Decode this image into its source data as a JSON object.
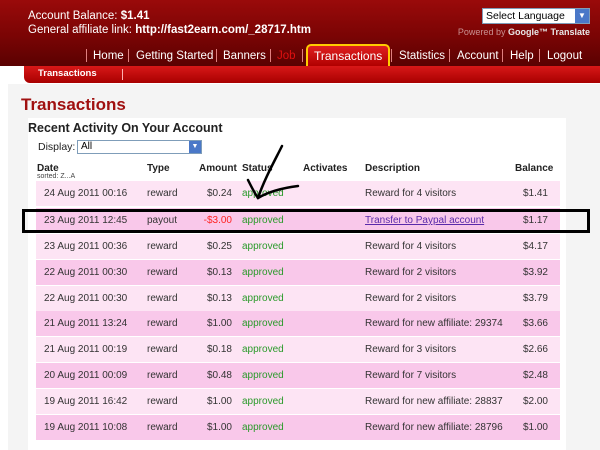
{
  "header": {
    "balance_label": "Account Balance:",
    "balance_value": "$1.41",
    "affiliate_label": "General affiliate link:",
    "affiliate_url": "http://fast2earn.com/_28717.htm",
    "language_select": "Select Language",
    "powered_by": "Powered by",
    "google_translate": "Google™ Translate"
  },
  "nav": {
    "items": [
      {
        "label": "Home"
      },
      {
        "label": "Getting Started"
      },
      {
        "label": "Banners"
      },
      {
        "label": "Job"
      },
      {
        "label": "Transactions"
      },
      {
        "label": "Statistics"
      },
      {
        "label": "Account"
      },
      {
        "label": "Help"
      },
      {
        "label": "Logout"
      }
    ],
    "sub_label": "Transactions"
  },
  "page": {
    "title": "Transactions",
    "section_title": "Recent Activity On Your Account",
    "display_label": "Display:",
    "display_value": "All"
  },
  "table": {
    "headers": {
      "date": "Date",
      "date_sub": "sorted: Z...A",
      "type": "Type",
      "amount": "Amount",
      "status": "Status",
      "activates": "Activates",
      "description": "Description",
      "balance": "Balance"
    },
    "rows": [
      {
        "date": "24 Aug 2011 00:16",
        "type": "reward",
        "amount": "$0.24",
        "status": "approved",
        "activates": "",
        "description": "Reward for 4 visitors",
        "balance": "$1.41"
      },
      {
        "date": "23 Aug 2011 12:45",
        "type": "payout",
        "amount": "-$3.00",
        "status": "approved",
        "activates": "",
        "description": "Transfer to Paypal account",
        "balance": "$1.17"
      },
      {
        "date": "23 Aug 2011 00:36",
        "type": "reward",
        "amount": "$0.25",
        "status": "approved",
        "activates": "",
        "description": "Reward for 4 visitors",
        "balance": "$4.17"
      },
      {
        "date": "22 Aug 2011 00:30",
        "type": "reward",
        "amount": "$0.13",
        "status": "approved",
        "activates": "",
        "description": "Reward for 2 visitors",
        "balance": "$3.92"
      },
      {
        "date": "22 Aug 2011 00:30",
        "type": "reward",
        "amount": "$0.13",
        "status": "approved",
        "activates": "",
        "description": "Reward for 2 visitors",
        "balance": "$3.79"
      },
      {
        "date": "21 Aug 2011 13:24",
        "type": "reward",
        "amount": "$1.00",
        "status": "approved",
        "activates": "",
        "description": "Reward for new affiliate: 29374",
        "balance": "$3.66"
      },
      {
        "date": "21 Aug 2011 00:19",
        "type": "reward",
        "amount": "$0.18",
        "status": "approved",
        "activates": "",
        "description": "Reward for 3 visitors",
        "balance": "$2.66"
      },
      {
        "date": "20 Aug 2011 00:09",
        "type": "reward",
        "amount": "$0.48",
        "status": "approved",
        "activates": "",
        "description": "Reward for 7 visitors",
        "balance": "$2.48"
      },
      {
        "date": "19 Aug 2011 16:42",
        "type": "reward",
        "amount": "$1.00",
        "status": "approved",
        "activates": "",
        "description": "Reward for new affiliate: 28837",
        "balance": "$2.00"
      },
      {
        "date": "19 Aug 2011 10:08",
        "type": "reward",
        "amount": "$1.00",
        "status": "approved",
        "activates": "",
        "description": "Reward for new affiliate: 28796",
        "balance": "$1.00"
      }
    ]
  },
  "colors": {
    "header_red": "#7a0404",
    "title_red": "#a01010",
    "status_green": "#2a9a2a",
    "negative_red": "#ff2222",
    "row_light": "#fde4f4",
    "row_dark": "#f9c8ea"
  }
}
